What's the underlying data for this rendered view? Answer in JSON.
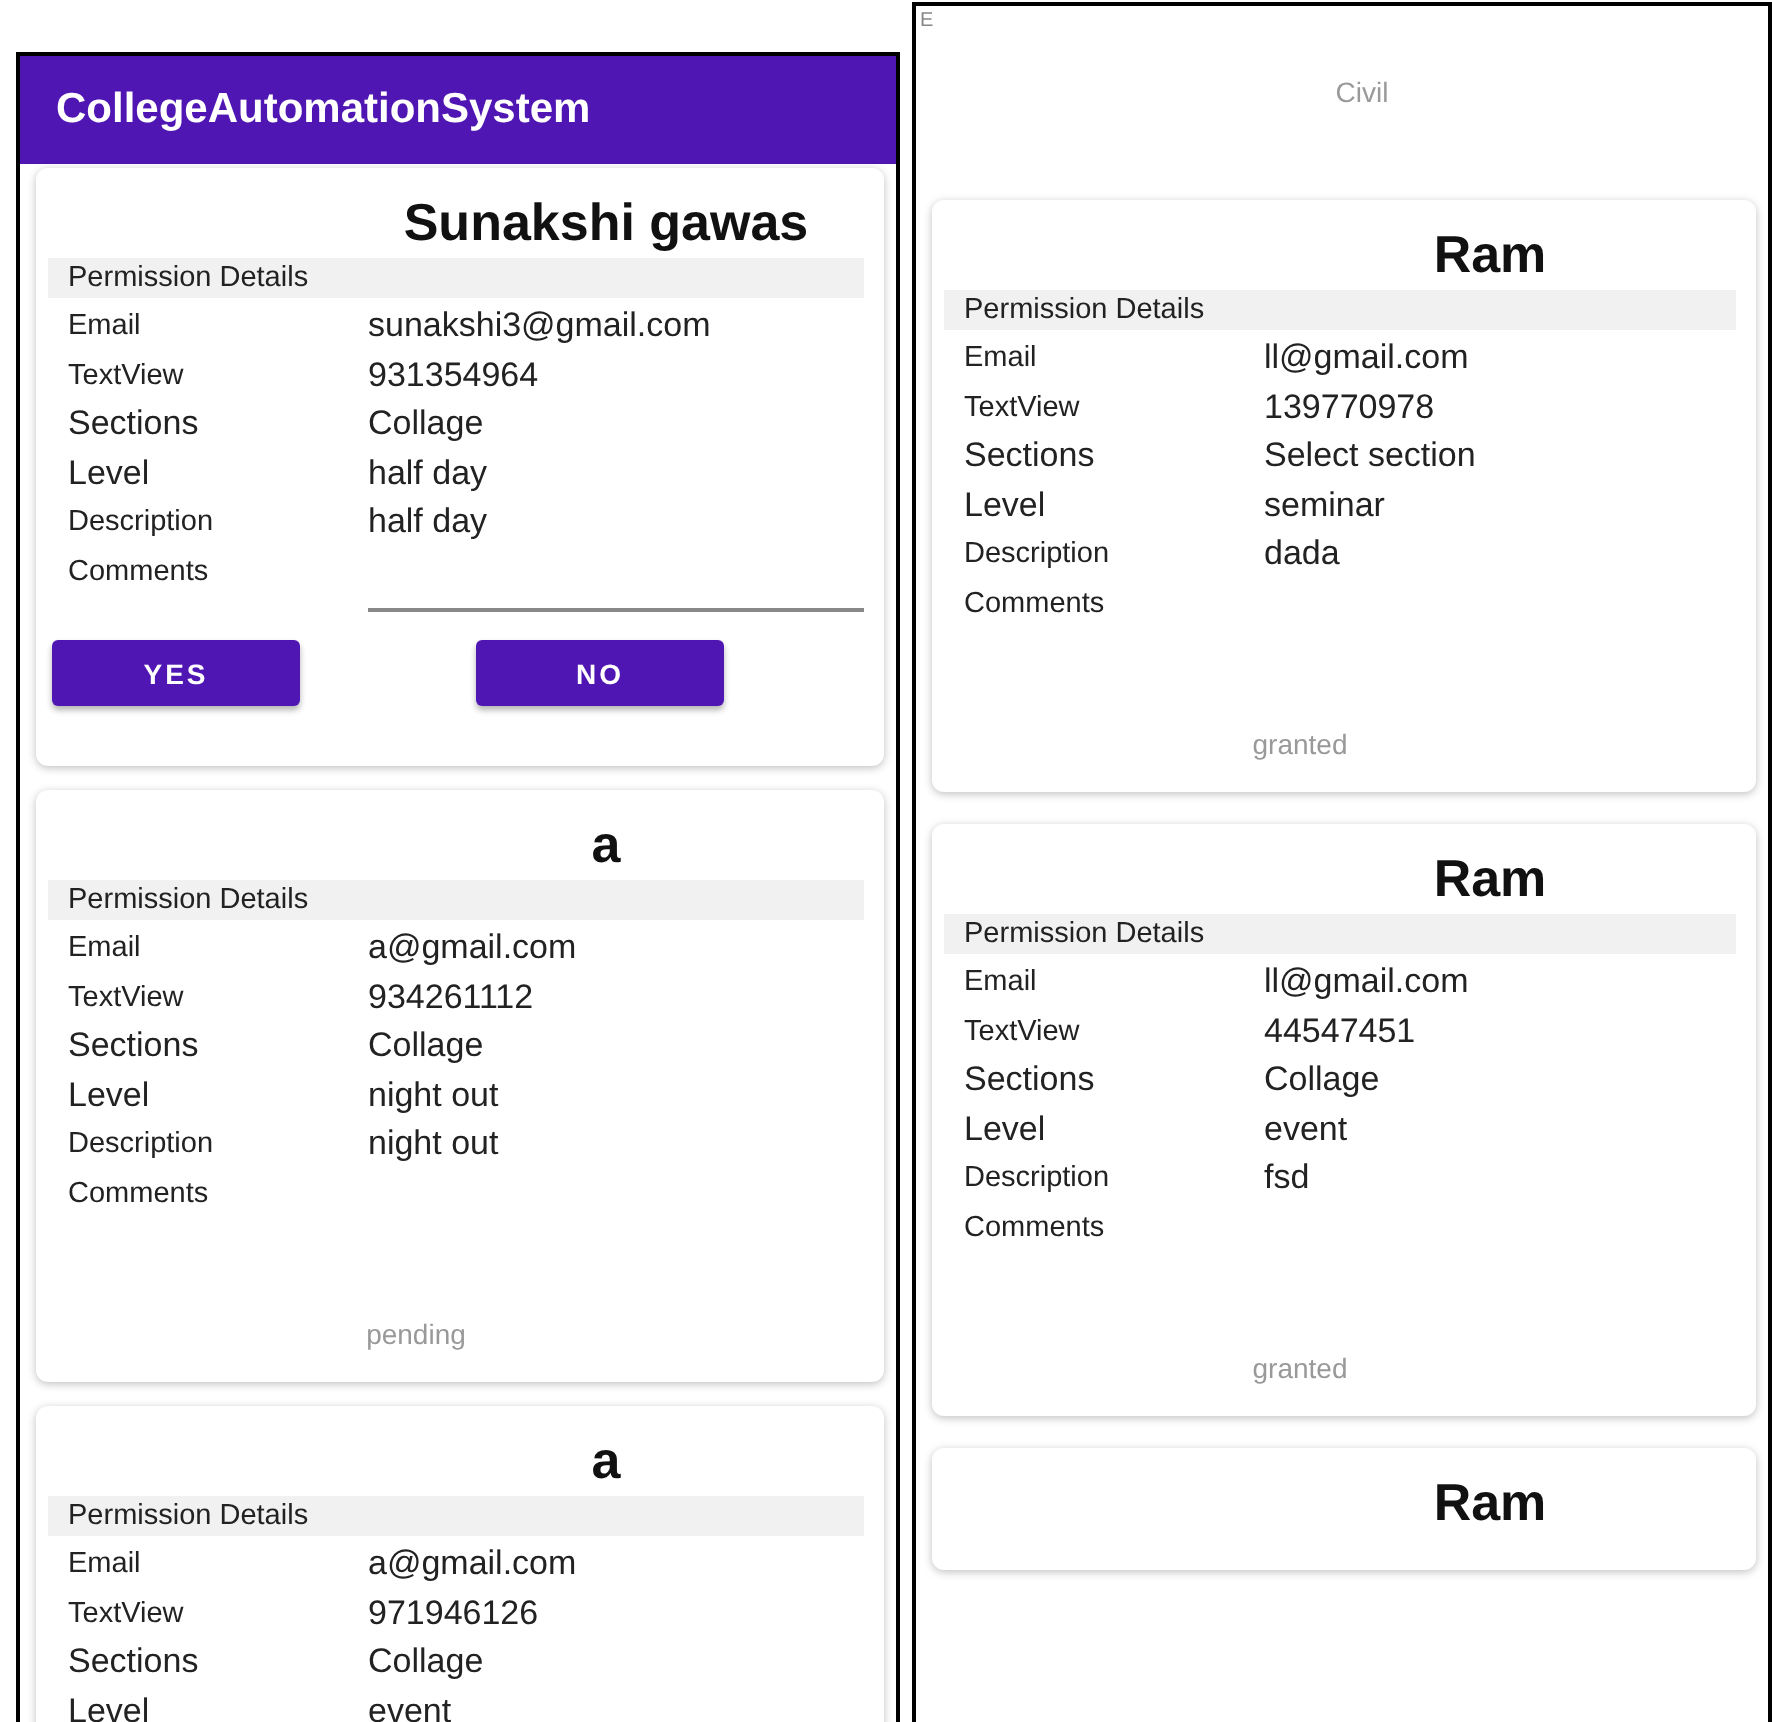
{
  "panels": [
    {
      "app_bar": {
        "title": "CollegeAutomationSystem"
      },
      "cards": [
        {
          "kind": "actions",
          "name": "Sunakshi gawas",
          "header": "Permission Details",
          "rows": [
            {
              "label": "Email",
              "value": "sunakshi3@gmail.com",
              "kind": "small"
            },
            {
              "label": "TextView",
              "value": "931354964",
              "kind": "small"
            },
            {
              "label": "Sections",
              "value": "Collage",
              "kind": "large"
            },
            {
              "label": "Level",
              "value": "half day",
              "kind": "large"
            },
            {
              "label": "Description",
              "value": "half day",
              "kind": "small"
            },
            {
              "label": "Comments",
              "kind": "small"
            }
          ],
          "buttons": [
            "YES",
            "NO"
          ]
        },
        {
          "kind": "status",
          "name": "a",
          "header": "Permission Details",
          "rows": [
            {
              "label": "Email",
              "value": "a@gmail.com",
              "kind": "small"
            },
            {
              "label": "TextView",
              "value": "934261112",
              "kind": "small"
            },
            {
              "label": "Sections",
              "value": "Collage",
              "kind": "large"
            },
            {
              "label": "Level",
              "value": "night out",
              "kind": "large"
            },
            {
              "label": "Description",
              "value": "night out",
              "kind": "small"
            },
            {
              "label": "Comments",
              "kind": "small"
            }
          ],
          "status": "pending"
        },
        {
          "kind": "status",
          "name": "a",
          "header": "Permission Details",
          "rows": [
            {
              "label": "Email",
              "value": "a@gmail.com",
              "kind": "small"
            },
            {
              "label": "TextView",
              "value": "971946126",
              "kind": "small"
            },
            {
              "label": "Sections",
              "value": "Collage",
              "kind": "large"
            },
            {
              "label": "Level",
              "value": "event",
              "kind": "large"
            }
          ]
        }
      ]
    },
    {
      "top_labels": [
        "E",
        "Civil"
      ],
      "cards": [
        {
          "kind": "status",
          "name": "Ram",
          "header": "Permission Details",
          "rows": [
            {
              "label": "Email",
              "value": "ll@gmail.com",
              "kind": "small"
            },
            {
              "label": "TextView",
              "value": "139770978",
              "kind": "small"
            },
            {
              "label": "Sections",
              "value": "Select section",
              "kind": "large"
            },
            {
              "label": "Level",
              "value": "seminar",
              "kind": "large"
            },
            {
              "label": "Description",
              "value": "dada",
              "kind": "small"
            },
            {
              "label": "Comments",
              "kind": "small"
            }
          ],
          "status": "granted"
        },
        {
          "kind": "status",
          "name": "Ram",
          "header": "Permission Details",
          "rows": [
            {
              "label": "Email",
              "value": "ll@gmail.com",
              "kind": "small"
            },
            {
              "label": "TextView",
              "value": "44547451",
              "kind": "small"
            },
            {
              "label": "Sections",
              "value": "Collage",
              "kind": "large"
            },
            {
              "label": "Level",
              "value": "event",
              "kind": "large"
            },
            {
              "label": "Description",
              "value": "fsd",
              "kind": "small"
            },
            {
              "label": "Comments",
              "kind": "small"
            }
          ],
          "status": "granted"
        },
        {
          "kind": "status",
          "name": "Ram"
        }
      ]
    }
  ]
}
